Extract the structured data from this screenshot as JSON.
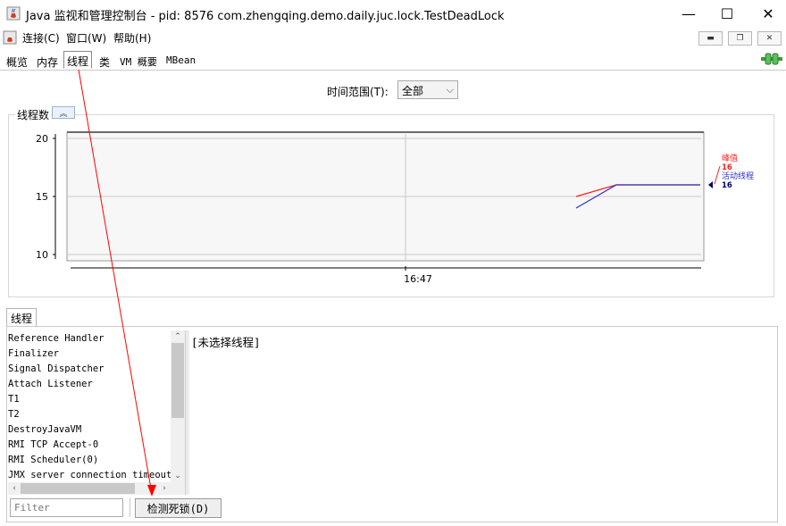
{
  "window": {
    "title": "Java 监视和管理控制台 - pid: 8576 com.zhengqing.demo.daily.juc.lock.TestDeadLock",
    "minimize": "—",
    "maximize": "☐",
    "close": "✕"
  },
  "menu": {
    "items": [
      "连接(C)",
      "窗口(W)",
      "帮助(H)"
    ],
    "mdi_min": "▬",
    "mdi_restore": "❐",
    "mdi_close": "✕"
  },
  "tabs": [
    "概览",
    "内存",
    "线程",
    "类",
    "VM 概要",
    "MBean"
  ],
  "selected_tab": "线程",
  "time_range": {
    "label": "时间范围(T):",
    "value": "全部",
    "chevron": "⌵"
  },
  "chart_panel": {
    "title": "线程数",
    "collapse_icon": "︽"
  },
  "chart_data": {
    "type": "line",
    "title": "",
    "ylim": [
      10,
      20
    ],
    "y_ticks": [
      "20",
      "15",
      "10"
    ],
    "x_ticks": [
      "16:47"
    ],
    "grid": true,
    "legend_placement": "right",
    "series": [
      {
        "name": "峰值",
        "color": "#ff2020",
        "values": [
          15,
          16,
          16,
          16
        ]
      },
      {
        "name": "活动线程",
        "color": "#3030c8",
        "values": [
          14,
          16,
          16,
          16
        ]
      }
    ],
    "legend": [
      {
        "name": "峰值",
        "value": "16",
        "color": "#ff2020"
      },
      {
        "name": "活动线程",
        "value": "16",
        "color": "#3030c8"
      }
    ]
  },
  "threads": {
    "tab_label": "线程",
    "items": [
      "Reference Handler",
      "Finalizer",
      "Signal Dispatcher",
      "Attach Listener",
      "T1",
      "T2",
      "DestroyJavaVM",
      "RMI TCP Accept-0",
      "RMI Scheduler(0)",
      "JMX server connection timeout"
    ],
    "detail": "[未选择线程]",
    "filter_placeholder": "Filter",
    "detect_button": "检测死锁(D)"
  },
  "colors": {
    "annotation_arrow": "#ff0000",
    "peak": "#ff2020",
    "live": "#3030c8"
  }
}
